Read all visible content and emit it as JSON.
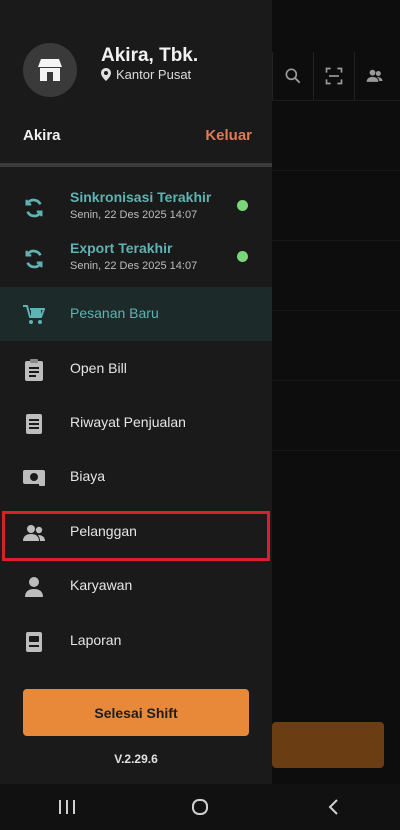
{
  "store": {
    "name": "Akira, Tbk.",
    "location": "Kantor Pusat"
  },
  "user": {
    "name": "Akira",
    "logout_label": "Keluar"
  },
  "sync": [
    {
      "title": "Sinkronisasi Terakhir",
      "timestamp": "Senin, 22 Des 2025 14:07",
      "status_color": "#7ad67a"
    },
    {
      "title": "Export Terakhir",
      "timestamp": "Senin, 22 Des 2025 14:07",
      "status_color": "#7ad67a"
    }
  ],
  "menu": [
    {
      "label": "Pesanan Baru",
      "icon": "cart-icon",
      "active": true
    },
    {
      "label": "Open Bill",
      "icon": "clipboard-icon"
    },
    {
      "label": "Riwayat Penjualan",
      "icon": "document-icon"
    },
    {
      "label": "Biaya",
      "icon": "cash-icon"
    },
    {
      "label": "Pelanggan",
      "icon": "customers-icon",
      "highlighted": true
    },
    {
      "label": "Karyawan",
      "icon": "person-icon"
    },
    {
      "label": "Laporan",
      "icon": "report-icon"
    }
  ],
  "footer": {
    "end_shift_label": "Selesai Shift",
    "version": "V.2.29.6"
  },
  "colors": {
    "accent": "#5fb3b3",
    "logout": "#e07a52",
    "button": "#e8893a",
    "highlight": "#d6202a"
  }
}
